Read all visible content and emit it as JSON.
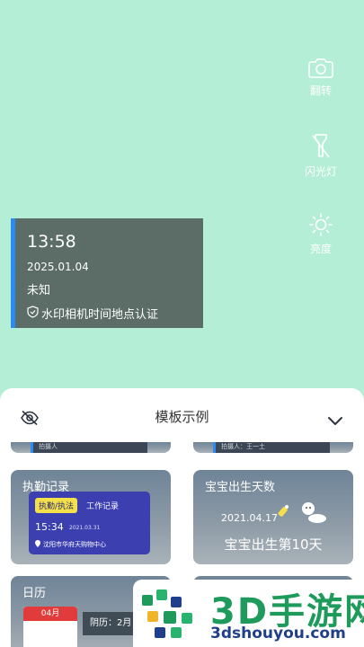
{
  "camera_controls": {
    "flip_label": "翻转",
    "flash_label": "闪光灯",
    "brightness_label": "亮度"
  },
  "watermark": {
    "time": "13:58",
    "date": "2025.01.04",
    "location": "未知",
    "auth_text": "水印相机时间地点认证",
    "accent_color": "#2a8cf0"
  },
  "template_sheet": {
    "title": "模板示例",
    "partial_top_left": "拍摄人",
    "partial_top_right": "拍摄人：王一土",
    "templates": {
      "attendance": {
        "title": "执勤记录",
        "badge": "执勤/执法",
        "worklog": "工作记录",
        "time": "15:34",
        "date": "2021.03.31",
        "place": "沈阳市华府天购物中心"
      },
      "baby": {
        "title": "宝宝出生天数",
        "date": "2021.04.17",
        "days_text": "宝宝出生第10天"
      },
      "calendar": {
        "title": "日历",
        "month": "04月",
        "lunar": "阴历：2月"
      }
    }
  },
  "brand_overlay": {
    "name": "3D手游网",
    "url": "3dshouyou.com",
    "color_green": "#1e9a5b",
    "color_blue": "#1f3f8a"
  }
}
